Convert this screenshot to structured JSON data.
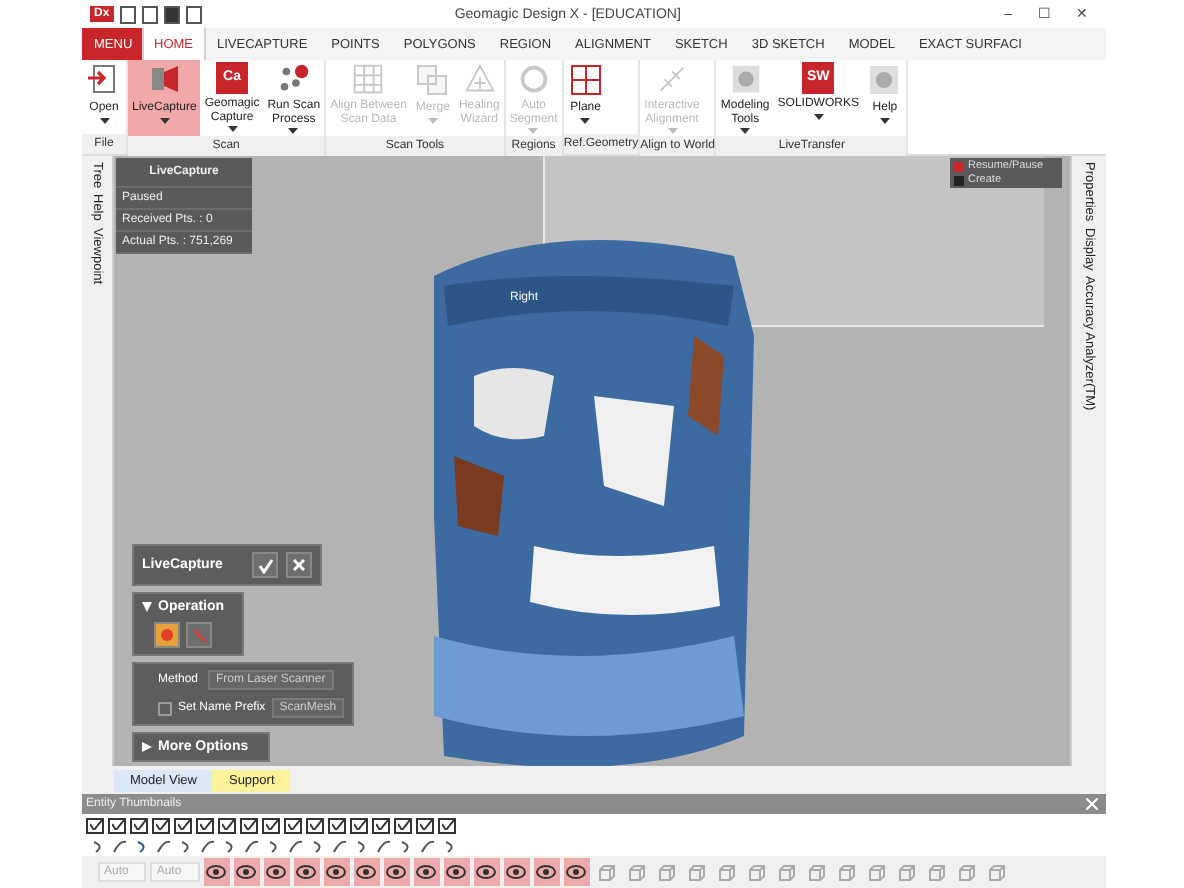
{
  "window": {
    "title": "Geomagic Design X - [EDUCATION]",
    "controls": [
      "–",
      "☐",
      "✕"
    ],
    "app_badge": "Dx"
  },
  "tabs": [
    {
      "label": "MENU",
      "kind": "menu"
    },
    {
      "label": "HOME",
      "kind": "tab",
      "selected": true
    },
    {
      "label": "LIVECAPTURE",
      "kind": "tab",
      "selected": false
    },
    {
      "label": "POINTS",
      "kind": "tab",
      "selected": false
    },
    {
      "label": "POLYGONS",
      "kind": "tab",
      "selected": false
    },
    {
      "label": "REGION",
      "kind": "tab",
      "selected": false
    },
    {
      "label": "ALIGNMENT",
      "kind": "tab",
      "selected": false
    },
    {
      "label": "SKETCH",
      "kind": "tab",
      "selected": false
    },
    {
      "label": "3D SKETCH",
      "kind": "tab",
      "selected": false
    },
    {
      "label": "MODEL",
      "kind": "tab",
      "selected": false
    },
    {
      "label": "EXACT SURFACI",
      "kind": "tab",
      "selected": false
    }
  ],
  "ribbon": [
    {
      "group": "File",
      "buttons": [
        {
          "kind": "icon",
          "lines": [
            "Open"
          ],
          "dropdown": true,
          "disabled": false,
          "selected": false
        }
      ]
    },
    {
      "group": "Scan",
      "buttons": [
        {
          "kind": "icon",
          "lines": [
            "LiveCapture"
          ],
          "dropdown": true,
          "disabled": false,
          "selected": true
        },
        {
          "kind": "logo",
          "logo_text": "Ca",
          "lines": [
            "Geomagic",
            "Capture"
          ],
          "dropdown": true,
          "disabled": false,
          "selected": false
        },
        {
          "kind": "icon",
          "lines": [
            "Run Scan",
            "Process"
          ],
          "dropdown": true,
          "disabled": false,
          "selected": false
        }
      ]
    },
    {
      "group": "Scan Tools",
      "buttons": [
        {
          "kind": "icon",
          "lines": [
            "Align Between",
            "Scan Data"
          ],
          "dropdown": false,
          "disabled": true,
          "selected": false
        },
        {
          "kind": "icon",
          "lines": [
            "Merge"
          ],
          "dropdown": true,
          "disabled": true,
          "selected": false
        },
        {
          "kind": "icon",
          "lines": [
            "Healing",
            "Wizard"
          ],
          "dropdown": false,
          "disabled": true,
          "selected": false
        }
      ]
    },
    {
      "group": "Regions",
      "buttons": [
        {
          "kind": "icon",
          "lines": [
            "Auto",
            "Segment"
          ],
          "dropdown": true,
          "disabled": true,
          "selected": false
        }
      ]
    },
    {
      "group": "Ref.Geometry",
      "buttons": [
        {
          "kind": "icon",
          "lines": [
            "Plane"
          ],
          "dropdown": true,
          "disabled": false,
          "selected": false
        }
      ]
    },
    {
      "group": "Align to World",
      "buttons": [
        {
          "kind": "icon",
          "lines": [
            "Interactive",
            "Alignment"
          ],
          "dropdown": true,
          "disabled": true,
          "selected": false
        }
      ]
    },
    {
      "group": "LiveTransfer",
      "buttons": [
        {
          "kind": "icon",
          "lines": [
            "Modeling",
            "Tools"
          ],
          "dropdown": true,
          "disabled": false,
          "selected": false
        },
        {
          "kind": "logo",
          "logo_text": "SW",
          "lines": [
            "SOLIDWORKS"
          ],
          "dropdown": true,
          "disabled": false,
          "selected": false
        },
        {
          "kind": "icon",
          "lines": [
            "Help"
          ],
          "dropdown": true,
          "disabled": false,
          "selected": false
        }
      ]
    }
  ],
  "left_panel_tabs": [
    "Tree",
    "Help",
    "Viewpoint"
  ],
  "right_panel_tabs": [
    "Properties",
    "Display",
    "Accuracy Analyzer(TM)"
  ],
  "viewport": {
    "view_label": "Right",
    "status_panel": {
      "title": "LiveCapture",
      "state": "Paused",
      "received": "Received Pts. : 0",
      "actual": "Actual Pts. : 751,269"
    },
    "legend": [
      "Resume/Pause",
      "Create"
    ],
    "feature_panel": {
      "title": "LiveCapture",
      "operation": {
        "label": "Operation",
        "expanded": true,
        "options": [
          {
            "selected": true
          },
          {
            "selected": false
          }
        ]
      },
      "method_label": "Method",
      "method_value": "From Laser Scanner",
      "prefix": {
        "label": "Set Name Prefix",
        "checked": false,
        "value": "ScanMesh"
      },
      "more_options": {
        "label": "More Options",
        "expanded": false
      }
    }
  },
  "view_tabs": [
    {
      "label": "Model View",
      "color": "#dbe7f5"
    },
    {
      "label": "Support",
      "color": "#fbf29a"
    }
  ],
  "entity_thumbnails": {
    "title": "Entity Thumbnails",
    "filters": [
      {
        "checked": true
      },
      {
        "checked": true
      },
      {
        "checked": true
      },
      {
        "checked": true
      },
      {
        "checked": true
      },
      {
        "checked": true
      },
      {
        "checked": true
      },
      {
        "checked": true
      },
      {
        "checked": true
      },
      {
        "checked": true
      },
      {
        "checked": true
      },
      {
        "checked": true
      },
      {
        "checked": true
      },
      {
        "checked": true
      },
      {
        "checked": true
      },
      {
        "checked": true
      },
      {
        "checked": true
      }
    ]
  },
  "toolbar": {
    "selects": [
      "Auto",
      "Auto"
    ],
    "tools": [
      {
        "active": true
      },
      {
        "active": true
      },
      {
        "active": true
      },
      {
        "active": true
      },
      {
        "active": true
      },
      {
        "active": true
      },
      {
        "active": true
      },
      {
        "active": true
      },
      {
        "active": true
      },
      {
        "active": true
      },
      {
        "active": true
      },
      {
        "active": true
      },
      {
        "active": true
      },
      {
        "active": false
      },
      {
        "active": false
      },
      {
        "active": false
      },
      {
        "active": false
      },
      {
        "active": false
      },
      {
        "active": false
      },
      {
        "active": false
      },
      {
        "active": false
      },
      {
        "active": false
      },
      {
        "active": false
      },
      {
        "active": false
      },
      {
        "active": false
      },
      {
        "active": false
      },
      {
        "active": false
      }
    ]
  }
}
